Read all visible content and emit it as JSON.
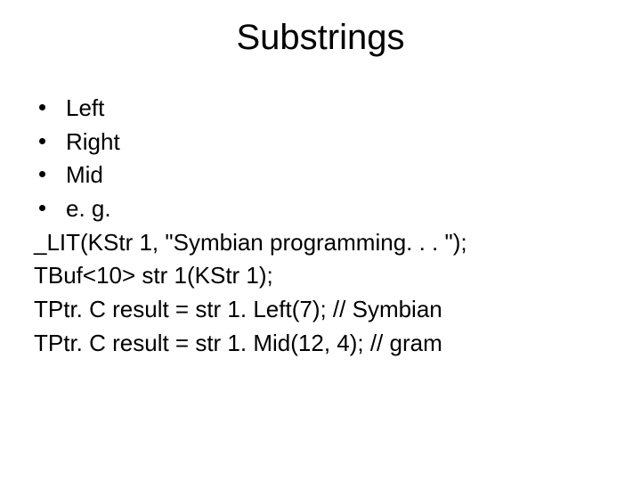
{
  "title": "Substrings",
  "bullets": {
    "item0": "Left",
    "item1": "Right",
    "item2": "Mid",
    "item3": "e. g."
  },
  "code": {
    "line0": "_LIT(KStr 1, \"Symbian programming. . . \");",
    "line1": "TBuf<10> str 1(KStr 1);",
    "line2": "TPtr. C result = str 1. Left(7); // Symbian",
    "line3": "TPtr. C result = str 1. Mid(12, 4); // gram"
  }
}
